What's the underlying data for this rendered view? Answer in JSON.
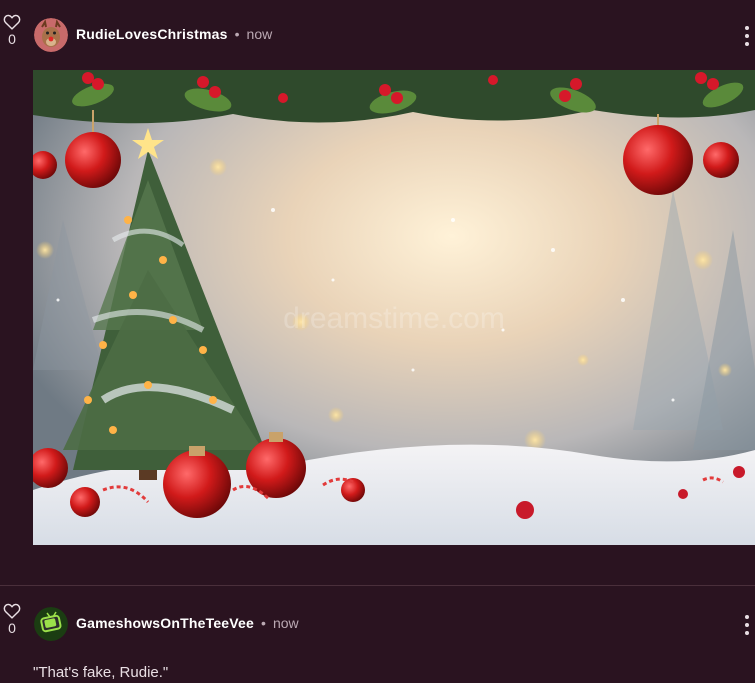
{
  "posts": [
    {
      "username": "RudieLovesChristmas",
      "separator": "•",
      "timestamp": "now",
      "likes": "0",
      "image_alt": "Christmas tree with ornaments and holly garland in snowy scene",
      "watermark": "dreamstime.com"
    },
    {
      "username": "GameshowsOnTheTeeVee",
      "separator": "•",
      "timestamp": "now",
      "likes": "0",
      "text": "\"That's fake, Rudie.\""
    }
  ],
  "icons": {
    "like": "heart-outline-icon",
    "menu": "kebab-menu-icon"
  },
  "colors": {
    "background": "#2a1320",
    "text": "#e9dfe4",
    "muted": "#bba9b3",
    "divider": "#4a2f3b"
  }
}
